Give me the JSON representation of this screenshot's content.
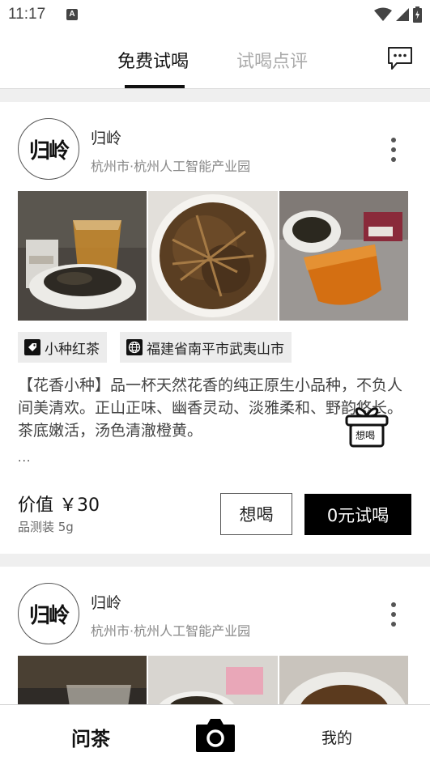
{
  "status_bar": {
    "time": "11:17",
    "notification_glyph": "A"
  },
  "header": {
    "tabs": [
      {
        "label": "免费试喝",
        "active": true
      },
      {
        "label": "试喝点评",
        "active": false
      }
    ],
    "message_icon": "chat-bubble-icon"
  },
  "posts": [
    {
      "shop_name": "归岭",
      "avatar_text": "归岭",
      "location": "杭州市·杭州人工智能产业园",
      "tags": [
        {
          "icon": "tag-icon",
          "label": "小种红茶"
        },
        {
          "icon": "globe-icon",
          "label": "福建省南平市武夷山市"
        }
      ],
      "description": "【花香小种】品一杯天然花香的纯正原生小品种，不负人间美清欢。正山正味、幽香灵动、淡雅柔和、野韵悠长。茶底嫩活，汤色清澈橙黄。",
      "ellipsis": "...",
      "gift_label": "想喝",
      "price": "价值 ￥30",
      "spec": "品测装 5g",
      "want_button": "想喝",
      "try_button": "0元试喝"
    },
    {
      "shop_name": "归岭",
      "avatar_text": "归岭",
      "location": "杭州市·杭州人工智能产业园"
    }
  ],
  "bottom_nav": {
    "ask": "问茶",
    "camera_icon": "camera-icon",
    "mine": "我的"
  },
  "colors": {
    "accent": "#000000",
    "muted": "#888888",
    "tab_inactive": "#aaaaaa"
  }
}
